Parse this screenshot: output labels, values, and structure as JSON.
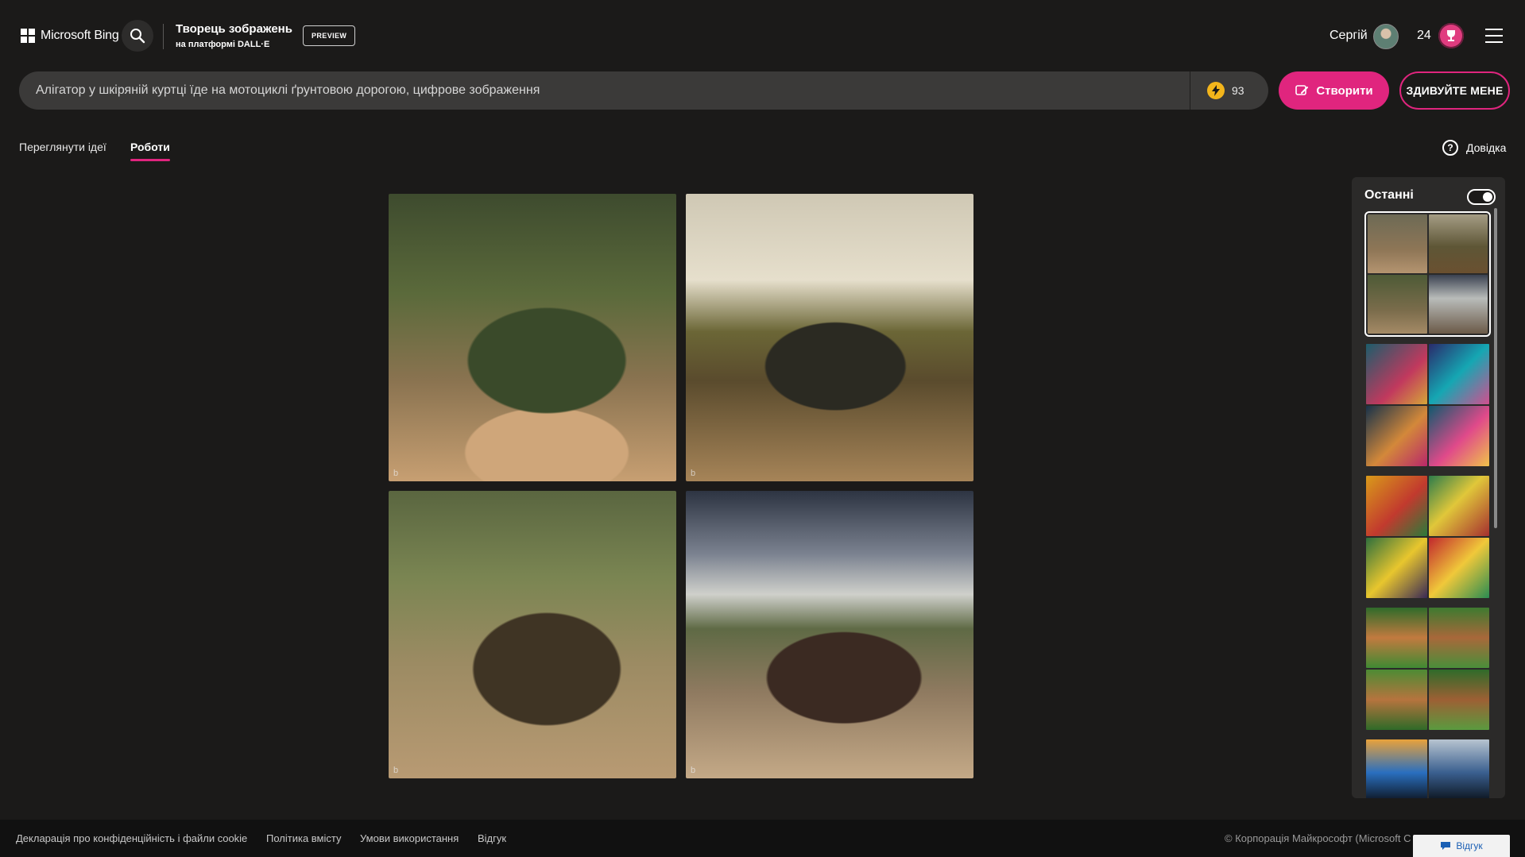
{
  "header": {
    "brand": "Microsoft Bing",
    "product_title": "Творець зображень",
    "product_subtitle": "на платформі DALL·E",
    "preview_label": "PREVIEW",
    "user_name": "Сергій",
    "reward_points": "24"
  },
  "prompt": {
    "value": "Алігатор у шкіряній куртці їде на мотоциклі ґрунтовою дорогою, цифрове зображення",
    "boosts": "93",
    "create_label": "Створити",
    "surprise_label": "ЗДИВУЙТЕ МЕНЕ"
  },
  "tabs": {
    "explore": "Переглянути ідеї",
    "creations": "Роботи",
    "help": "Довідка"
  },
  "results": {
    "images": [
      {
        "description": "alligator-motorcycle-1",
        "mark": "b"
      },
      {
        "description": "alligator-motorcycle-2",
        "mark": "b"
      },
      {
        "description": "alligator-motorcycle-3",
        "mark": "b"
      },
      {
        "description": "alligator-motorcycle-4",
        "mark": "b"
      }
    ]
  },
  "recent": {
    "title": "Останні",
    "toggle_on": true,
    "groups_count": 5
  },
  "footer": {
    "links": [
      "Декларація про конфіденційність і файли cookie",
      "Політика вмісту",
      "Умови використання",
      "Відгук"
    ],
    "copyright": "© Корпорація Майкрософт (Microsoft C",
    "feedback_button": "Відгук"
  },
  "colors": {
    "accent": "#e0257e",
    "background": "#1b1a19",
    "boost": "#f3b51b"
  }
}
